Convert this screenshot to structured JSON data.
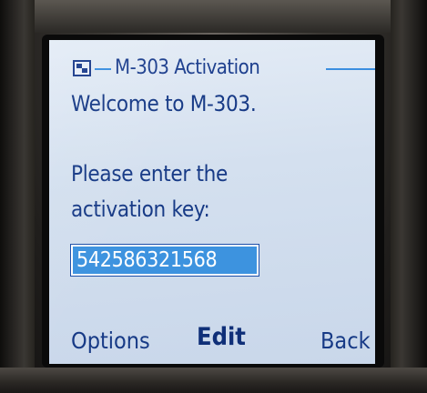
{
  "window": {
    "title": "M-303 Activation"
  },
  "content": {
    "welcome": "Welcome to M-303.",
    "prompt_line1": "Please enter the",
    "prompt_line2": "activation key:"
  },
  "key_input": {
    "value": "542586321568"
  },
  "softkeys": {
    "left": "Options",
    "center": "Edit",
    "right": "Back"
  },
  "colors": {
    "text": "#173a86",
    "accent": "#3b8fe0",
    "selection": "#3d93df"
  },
  "icons": {
    "title_icon": "app-window-icon"
  }
}
